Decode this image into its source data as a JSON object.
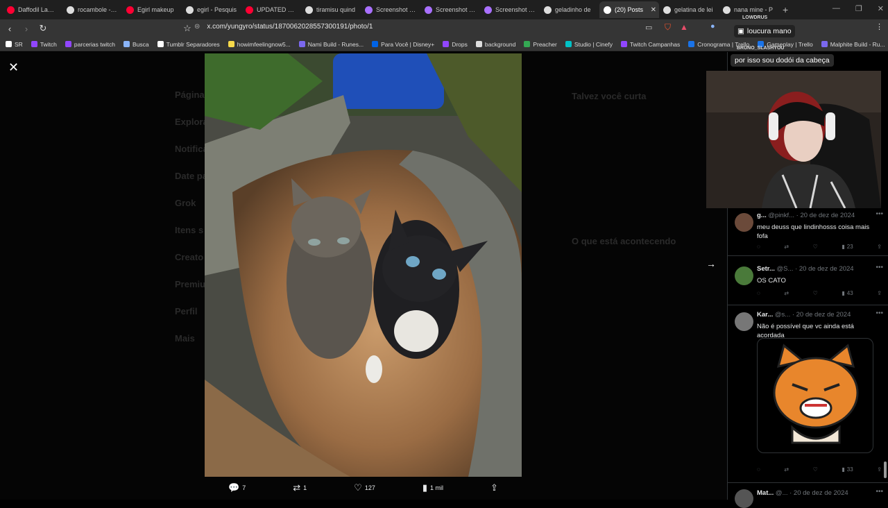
{
  "browser": {
    "tabs": [
      {
        "label": "Daffodil Lamen",
        "color": "#ff0033"
      },
      {
        "label": "rocambole - Pe",
        "color": "#dddddd"
      },
      {
        "label": "Egirl makeup",
        "color": "#ff0033"
      },
      {
        "label": "egirl - Pesquis",
        "color": "#dddddd"
      },
      {
        "label": "UPDATED y2k",
        "color": "#ff0033"
      },
      {
        "label": "tiramisu quind",
        "color": "#dddddd"
      },
      {
        "label": "Screenshot po",
        "color": "#a970ff"
      },
      {
        "label": "Screenshot po",
        "color": "#a970ff"
      },
      {
        "label": "Screenshot po",
        "color": "#a970ff"
      },
      {
        "label": "geladinho de",
        "color": "#dddddd"
      },
      {
        "label": "(20) Posts",
        "color": "#ffffff",
        "active": true
      },
      {
        "label": "gelatina de lei",
        "color": "#dddddd"
      },
      {
        "label": "nana mine - P",
        "color": "#dddddd"
      }
    ],
    "url": "x.com/yungyro/status/1870062028557300191/photo/1",
    "bookmarks": [
      {
        "label": "SR",
        "color": "#ffffff"
      },
      {
        "label": "Twitch",
        "color": "#9146ff"
      },
      {
        "label": "parcerias twitch",
        "color": "#9146ff"
      },
      {
        "label": "Busca",
        "color": "#8ab4f8"
      },
      {
        "label": "Tumblr Separadores",
        "color": "#ffffff"
      },
      {
        "label": "howimfeelingnow5...",
        "color": "#f6d94a"
      },
      {
        "label": "Nami Build - Runes...",
        "color": "#7b68ee"
      },
      {
        "label": "Para Você | Disney+",
        "color": "#0063e5"
      },
      {
        "label": "Drops",
        "color": "#9146ff"
      },
      {
        "label": "background",
        "color": "#dddddd"
      },
      {
        "label": "Preacher",
        "color": "#34a853"
      },
      {
        "label": "Studio | Cinefy",
        "color": "#00c2c7"
      },
      {
        "label": "Twitch Campanhas",
        "color": "#9146ff"
      },
      {
        "label": "Cronograma | Trello",
        "color": "#1a73e8"
      },
      {
        "label": "Gameplay | Trello",
        "color": "#1a73e8"
      },
      {
        "label": "Malphite Build - Ru...",
        "color": "#7b68ee"
      }
    ]
  },
  "viewer": {
    "ghost_nav": [
      "Página",
      "Explorar",
      "Notificações",
      "Date pa",
      "Grok",
      "Itens s",
      "Creato",
      "Premiu",
      "Perfil",
      "Mais"
    ],
    "ghost_right": [
      "Talvez você curta",
      "O que está acontecendo"
    ],
    "actions": [
      {
        "icon": "reply-icon",
        "glyph": "💬",
        "count": "7"
      },
      {
        "icon": "retweet-icon",
        "glyph": "⇄",
        "count": "1"
      },
      {
        "icon": "like-icon",
        "glyph": "♡",
        "count": "127"
      },
      {
        "icon": "views-icon",
        "glyph": "▮",
        "count": "1 mil"
      },
      {
        "icon": "share-icon",
        "glyph": "⇪",
        "count": ""
      }
    ]
  },
  "replies": [
    {
      "name": "g...",
      "handle": "@pinkf...",
      "date": "· 20 de dez de 2024",
      "text": "meu deuss que lindinhosss coisa mais fofa",
      "views": "23",
      "avatar_color": "#6b4a3a"
    },
    {
      "name": "Setr...",
      "handle": "@S...",
      "date": "· 20 de dez de 2024",
      "text": "OS CATO",
      "views": "43",
      "avatar_color": "#4a7a3a"
    },
    {
      "name": "Kar...",
      "handle": "@s...",
      "date": "· 20 de dez de 2024",
      "text": "Não é possível que vc ainda está acordada",
      "views": "33",
      "avatar_color": "#777777"
    },
    {
      "name": "Mat...",
      "handle": "@...",
      "date": "· 20 de dez de 2024",
      "text": "",
      "views": "",
      "avatar_color": "#555555"
    }
  ],
  "stream": {
    "chat_user_top": "LOWDRUS",
    "chat_message_1": "loucura mano",
    "chat_user_2": "BRUNO_SLASHYOU",
    "chat_message_2": "por isso sou dodói da cabeça"
  }
}
